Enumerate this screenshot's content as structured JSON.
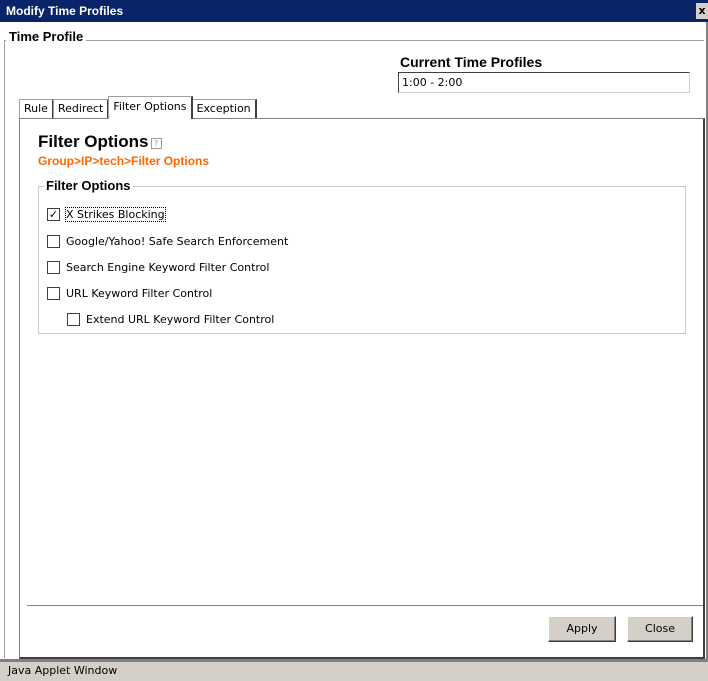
{
  "window": {
    "title": "Modify Time Profiles",
    "close_glyph": "x",
    "status": "Java Applet Window"
  },
  "time_profile": {
    "legend": "Time Profile",
    "current_label": "Current Time Profiles",
    "current_value": "1:00 - 2:00"
  },
  "tabs": [
    {
      "label": "Rule",
      "active": false
    },
    {
      "label": "Redirect",
      "active": false
    },
    {
      "label": "Filter Options",
      "active": true
    },
    {
      "label": "Exception",
      "active": false
    }
  ],
  "panel": {
    "title": "Filter Options",
    "help_glyph": "?",
    "breadcrumb": "Group>IP>tech>Filter Options",
    "group_legend": "Filter Options"
  },
  "options": [
    {
      "label": "X Strikes Blocking",
      "checked": true
    },
    {
      "label": "Google/Yahoo! Safe Search Enforcement",
      "checked": false
    },
    {
      "label": "Search Engine Keyword Filter Control",
      "checked": false
    },
    {
      "label": "URL Keyword Filter Control",
      "checked": false
    },
    {
      "label": "Extend URL Keyword Filter Control",
      "checked": false
    }
  ],
  "buttons": {
    "apply": "Apply",
    "close": "Close"
  },
  "colors": {
    "title_bar": "#0a246a",
    "breadcrumb": "#ff6600",
    "button_face": "#d4d0c8"
  }
}
